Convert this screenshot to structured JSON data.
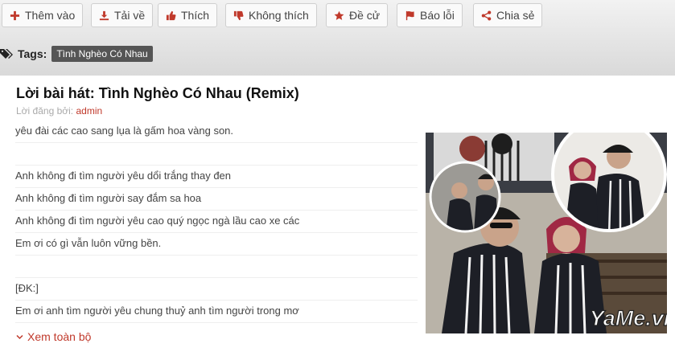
{
  "toolbar": {
    "buttons": [
      {
        "label": "Thêm vào",
        "icon": "plus-icon"
      },
      {
        "label": "Tải về",
        "icon": "download-icon"
      },
      {
        "label": "Thích",
        "icon": "thumbs-up-icon"
      },
      {
        "label": "Không thích",
        "icon": "thumbs-down-icon"
      },
      {
        "label": "Đề cử",
        "icon": "star-icon"
      },
      {
        "label": "Báo lỗi",
        "icon": "flag-icon"
      },
      {
        "label": "Chia sẻ",
        "icon": "share-icon"
      }
    ]
  },
  "tags": {
    "label": "Tags:",
    "items": [
      "Tình Nghèo Có Nhau"
    ]
  },
  "article": {
    "title": "Lời bài hát: Tình Nghèo Có Nhau (Remix)",
    "byline_prefix": "Lời đăng bởi:",
    "author": "admin",
    "lyrics": [
      "yêu đài các cao sang lụa là gấm hoa vàng son.",
      "",
      "Anh không đi tìm người yêu dổi trắng thay đen",
      "Anh không đi tìm người say đắm sa hoa",
      "Anh không đi tìm người yêu cao quý ngọc ngà lầu cao xe các",
      "Em ơi có gì vẫn luôn vững bền.",
      "",
      "[ĐK:]",
      "Em ơi anh tìm người yêu chung thuỷ anh tìm người trong mơ"
    ],
    "show_more_label": "Xem toàn bộ"
  },
  "image": {
    "watermark": "YaMe.vn"
  },
  "colors": {
    "accent_red": "#c0392b",
    "toolbar_icon": "#c0392b"
  }
}
